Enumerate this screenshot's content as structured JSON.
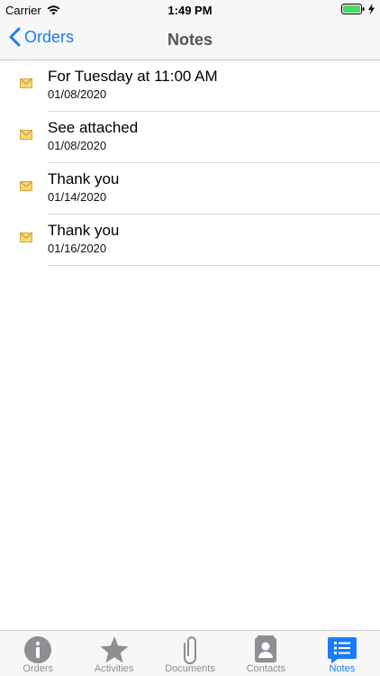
{
  "status_bar": {
    "carrier": "Carrier",
    "time": "1:49 PM"
  },
  "nav": {
    "back_label": "Orders",
    "title": "Notes"
  },
  "notes": [
    {
      "title": "For Tuesday at 11:00 AM",
      "date": "01/08/2020"
    },
    {
      "title": "See attached",
      "date": "01/08/2020"
    },
    {
      "title": "Thank you",
      "date": "01/14/2020"
    },
    {
      "title": "Thank you",
      "date": "01/16/2020"
    }
  ],
  "tabs": [
    {
      "label": "Orders",
      "icon": "info-icon"
    },
    {
      "label": "Activities",
      "icon": "star-icon"
    },
    {
      "label": "Documents",
      "icon": "paperclip-icon"
    },
    {
      "label": "Contacts",
      "icon": "contacts-icon"
    },
    {
      "label": "Notes",
      "icon": "notes-icon",
      "active": true
    }
  ],
  "colors": {
    "accent": "#1a7cf5",
    "inactive": "#8e8e93",
    "battery": "#4cd964"
  }
}
